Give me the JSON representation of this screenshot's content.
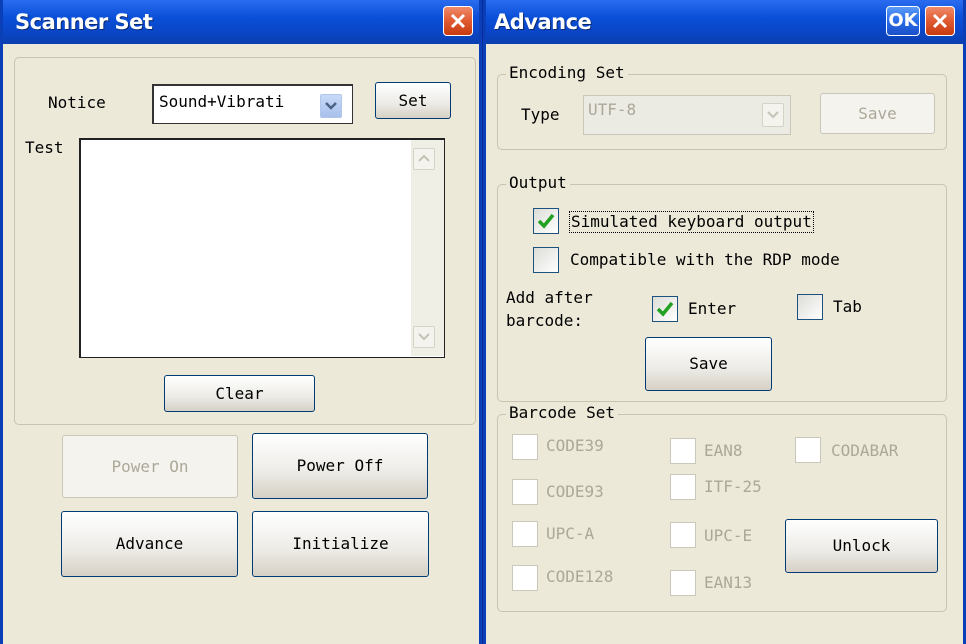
{
  "scanner_window": {
    "title": "Scanner Set",
    "notice_label": "Notice",
    "notice_value": "Sound+Vibrati",
    "set_button": "Set",
    "test_label": "Test",
    "test_text": "",
    "clear_button": "Clear",
    "power_on_button": "Power On",
    "power_off_button": "Power Off",
    "advance_button": "Advance",
    "initialize_button": "Initialize"
  },
  "advance_window": {
    "title": "Advance",
    "ok_button": "OK",
    "encoding_group": "Encoding Set",
    "type_label": "Type",
    "type_value": "UTF-8",
    "encoding_save": "Save",
    "output_group": "Output",
    "simulated_keyboard": {
      "label": "Simulated keyboard output",
      "checked": true
    },
    "rdp_mode": {
      "label": "Compatible with the RDP mode",
      "checked": false
    },
    "add_after_line1": "Add after",
    "add_after_line2": "barcode:",
    "enter": {
      "label": "Enter",
      "checked": true
    },
    "tab": {
      "label": "Tab",
      "checked": false
    },
    "output_save": "Save",
    "barcode_group": "Barcode Set",
    "barcodes": {
      "code39": "CODE39",
      "ean8": "EAN8",
      "codabar": "CODABAR",
      "code93": "CODE93",
      "itf25": "ITF-25",
      "upca": "UPC-A",
      "upce": "UPC-E",
      "code128": "CODE128",
      "ean13": "EAN13"
    },
    "unlock_button": "Unlock"
  },
  "colors": {
    "title_bar": "#0a4fd8",
    "window_bg": "#ece9d8",
    "close_red": "#e05a30",
    "check_green": "#21a121"
  }
}
